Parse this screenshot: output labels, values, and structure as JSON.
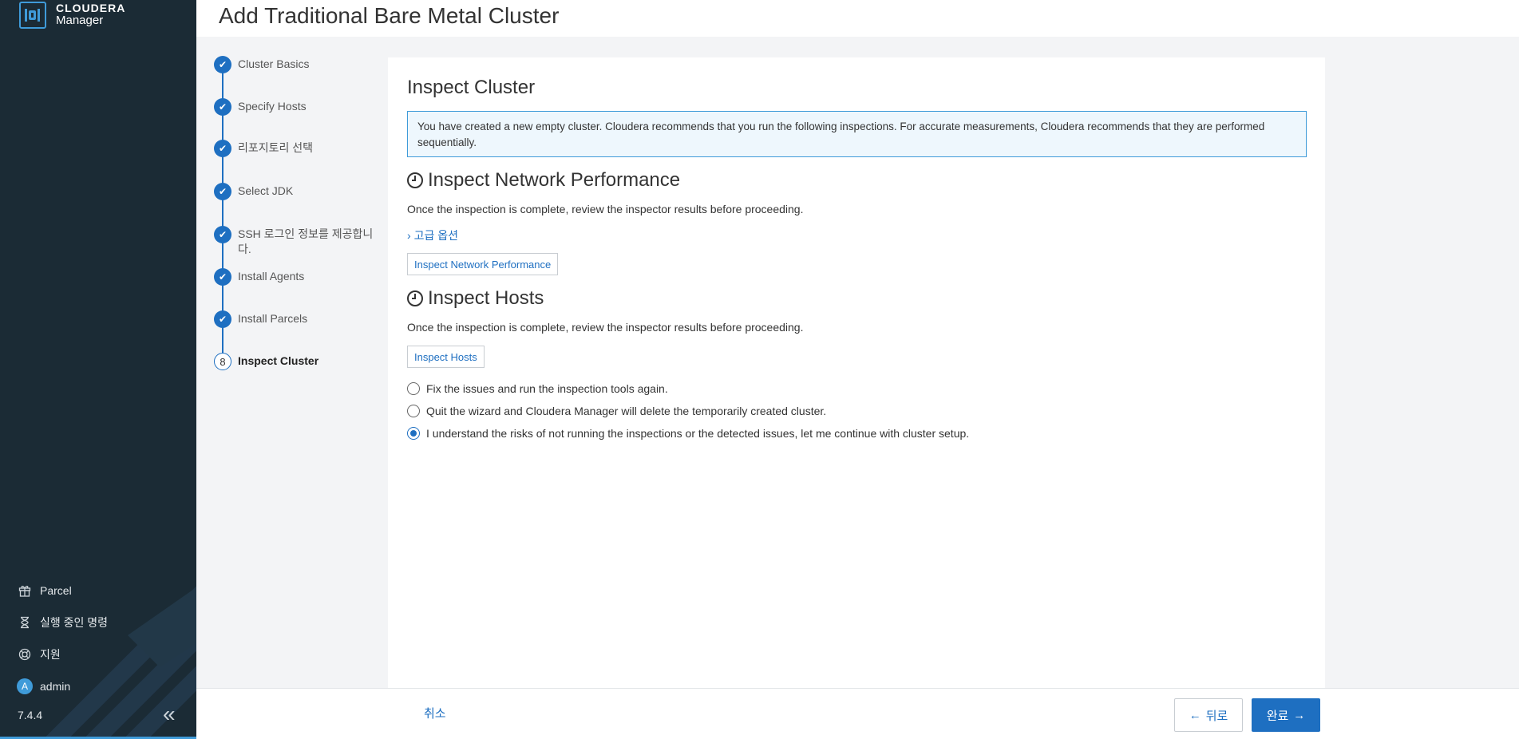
{
  "app": {
    "brand": "CLOUDERA",
    "product": "Manager",
    "version": "7.4.4"
  },
  "page": {
    "title": "Add Traditional Bare Metal Cluster"
  },
  "sidebar": {
    "items": [
      {
        "label": "Parcel",
        "icon": "gift-icon"
      },
      {
        "label": "실행 중인 명령",
        "icon": "hourglass-icon"
      },
      {
        "label": "지원",
        "icon": "lifebuoy-icon"
      },
      {
        "label": "admin",
        "icon": "avatar",
        "avatar_letter": "A"
      }
    ]
  },
  "steps": [
    {
      "label": "Cluster Basics",
      "status": "done"
    },
    {
      "label": "Specify Hosts",
      "status": "done"
    },
    {
      "label": "리포지토리 선택",
      "status": "done"
    },
    {
      "label": "Select JDK",
      "status": "done"
    },
    {
      "label": "SSH 로그인 정보를 제공합니다.",
      "status": "done"
    },
    {
      "label": "Install Agents",
      "status": "done"
    },
    {
      "label": "Install Parcels",
      "status": "done"
    },
    {
      "label": "Inspect Cluster",
      "status": "current",
      "number": "8"
    }
  ],
  "main": {
    "heading": "Inspect Cluster",
    "alert": "You have created a new empty cluster. Cloudera recommends that you run the following inspections. For accurate measurements, Cloudera recommends that they are performed sequentially.",
    "network": {
      "title": "Inspect Network Performance",
      "desc": "Once the inspection is complete, review the inspector results before proceeding.",
      "advanced": "고급 옵션",
      "button": "Inspect Network Performance"
    },
    "hosts": {
      "title": "Inspect Hosts",
      "desc": "Once the inspection is complete, review the inspector results before proceeding.",
      "button": "Inspect Hosts"
    },
    "options": [
      {
        "label": "Fix the issues and run the inspection tools again.",
        "checked": false
      },
      {
        "label": "Quit the wizard and Cloudera Manager will delete the temporarily created cluster.",
        "checked": false
      },
      {
        "label": "I understand the risks of not running the inspections or the detected issues, let me continue with cluster setup.",
        "checked": true
      }
    ]
  },
  "footer": {
    "cancel": "취소",
    "back": "뒤로",
    "finish": "완료"
  },
  "colors": {
    "sidebar_bg": "#1b2b35",
    "accent": "#1e6fc1",
    "logo_blue": "#3f9bd9"
  }
}
